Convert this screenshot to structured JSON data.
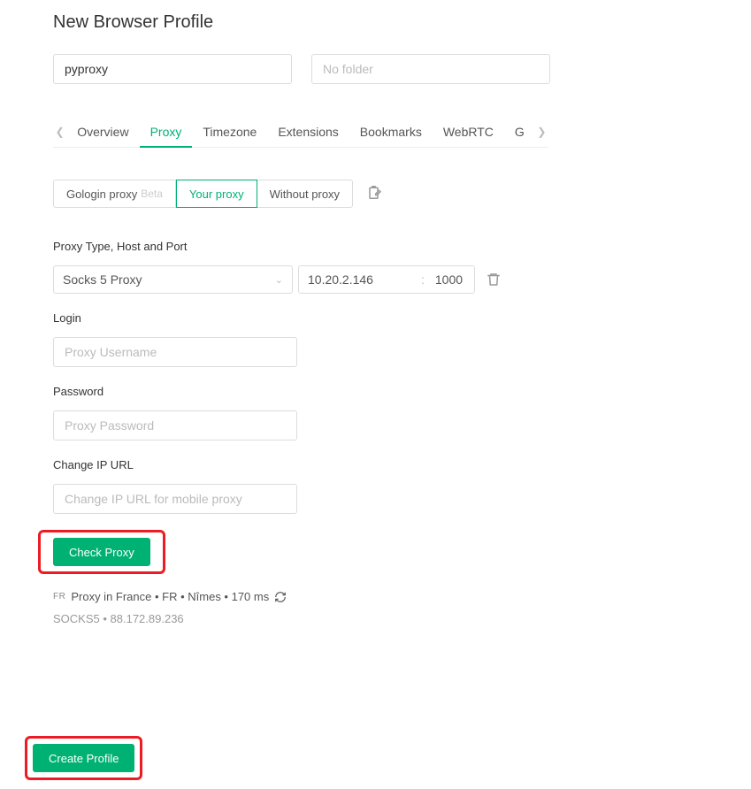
{
  "page": {
    "title": "New Browser Profile"
  },
  "top": {
    "profile_name_value": "pyproxy",
    "folder_placeholder": "No folder"
  },
  "tabs": {
    "items": [
      "Overview",
      "Proxy",
      "Timezone",
      "Extensions",
      "Bookmarks",
      "WebRTC",
      "G"
    ],
    "active_index": 1
  },
  "source": {
    "options": [
      {
        "label": "Gologin proxy",
        "beta": "Beta"
      },
      {
        "label": "Your proxy"
      },
      {
        "label": "Without proxy"
      }
    ],
    "active_index": 1
  },
  "proxy": {
    "section_label": "Proxy Type, Host and Port",
    "type_selected": "Socks 5 Proxy",
    "host_value": "10.20.2.146",
    "port_value": "1000"
  },
  "login": {
    "label": "Login",
    "placeholder": "Proxy Username"
  },
  "password": {
    "label": "Password",
    "placeholder": "Proxy Password"
  },
  "changeip": {
    "label": "Change IP URL",
    "placeholder": "Change IP URL for mobile proxy"
  },
  "buttons": {
    "check_proxy": "Check Proxy",
    "create_profile": "Create Profile"
  },
  "status": {
    "country_code": "FR",
    "line1": "Proxy in France • FR • Nîmes • 170 ms",
    "line2": "SOCKS5 • 88.172.89.236"
  }
}
